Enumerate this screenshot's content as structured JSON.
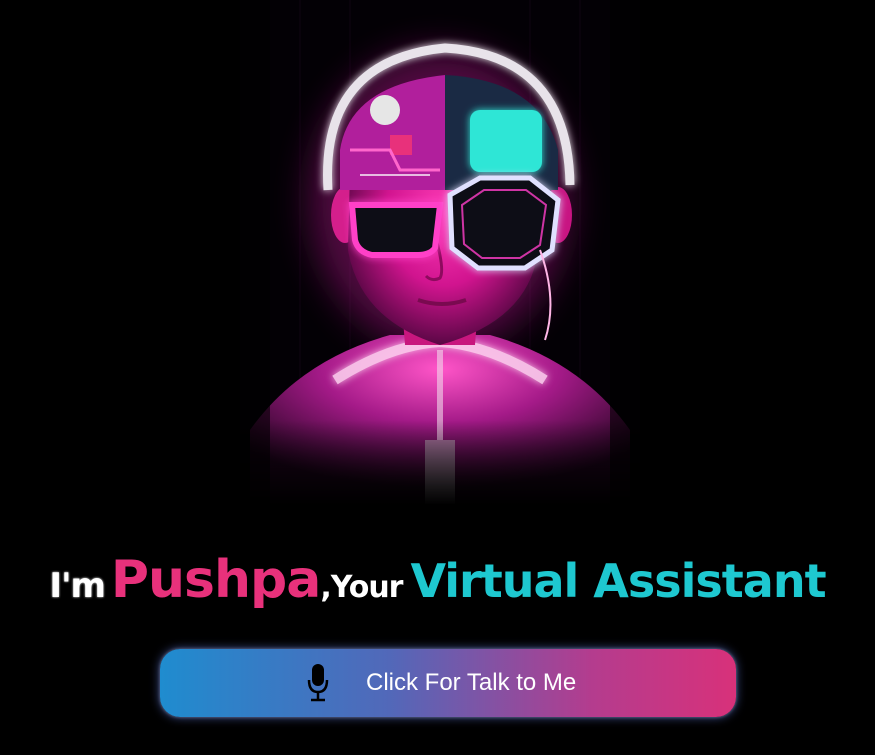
{
  "hero": {
    "avatar_icon": "cyberpunk-avatar-icon"
  },
  "heading": {
    "im": "I'm",
    "name": "Pushpa",
    "comma_your": ",Your",
    "virtual_assistant": "Virtual Assistant"
  },
  "talk_button": {
    "label": "Click For Talk to Me",
    "icon": "microphone-icon"
  },
  "colors": {
    "background": "#000000",
    "name_pink": "#e8317b",
    "assistant_cyan": "#1ec8d0",
    "button_start": "#1f8ccf",
    "button_end": "#d8317a",
    "neon_magenta": "#ff1fb8",
    "neon_teal": "#2fe6d6"
  }
}
